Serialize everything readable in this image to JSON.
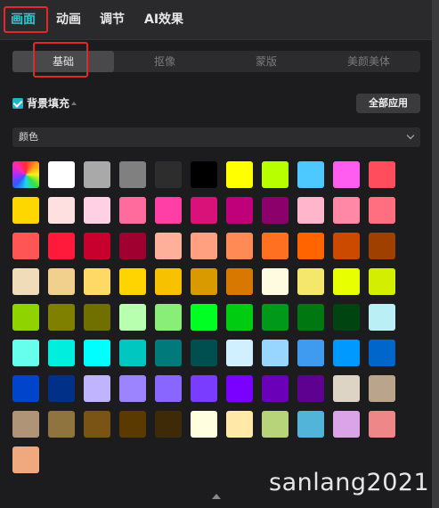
{
  "top_tabs": [
    {
      "label": "画面",
      "active": true
    },
    {
      "label": "动画",
      "active": false
    },
    {
      "label": "调节",
      "active": false
    },
    {
      "label": "AI效果",
      "active": false
    }
  ],
  "sub_tabs": [
    {
      "label": "基础",
      "active": true
    },
    {
      "label": "抠像",
      "active": false
    },
    {
      "label": "蒙版",
      "active": false
    },
    {
      "label": "美颜美体",
      "active": false
    }
  ],
  "fill": {
    "checked": true,
    "label": "背景填充",
    "apply_all_label": "全部应用"
  },
  "dropdown": {
    "value": "颜色"
  },
  "accent_color": "#31c5d2",
  "swatch_rows": [
    [
      "rainbow",
      "#ffffff",
      "#a9a9a9",
      "#808080",
      "#2d2d2d",
      "#000000",
      "#ffff00",
      "#b8ff00",
      "#4dc9ff",
      "#ff5cf0",
      "#ff4d5e"
    ],
    [
      "#ffd700",
      "#ffe0e0",
      "#ffd0e4",
      "#ff6b9c",
      "#ff3fa6",
      "#d9127a",
      "#c0007a",
      "#8b006b",
      "#ffb6cc",
      "#ff88a6",
      "#ff6f7f"
    ],
    [
      "#ff5555",
      "#ff1a3c",
      "#c8002e",
      "#a00030",
      "#ffb09a",
      "#ffa080",
      "#ff8a55",
      "#ff7020",
      "#ff6400",
      "#cc4a00",
      "#a04000"
    ],
    [
      "#f0dcb8",
      "#f0d08c",
      "#ffd966",
      "#ffd400",
      "#f7c100",
      "#d99a00",
      "#d97800",
      "#fffbe0",
      "#f5e66c",
      "#e8ff00",
      "#d4ee00"
    ],
    [
      "#8fd400",
      "#808000",
      "#707000",
      "#b8ffb0",
      "#88ee77",
      "#00ff22",
      "#00cc11",
      "#00991a",
      "#007711",
      "#004411",
      "#baf0f5"
    ],
    [
      "#66ffee",
      "#00eedd",
      "#00ffff",
      "#00c8c0",
      "#007a7a",
      "#004f50",
      "#d0f0ff",
      "#99d6ff",
      "#3f9bf0",
      "#0099ff",
      "#0066cc"
    ],
    [
      "#0044cc",
      "#003088",
      "#c0b4ff",
      "#9c84ff",
      "#8866ff",
      "#7a3dff",
      "#7a00ff",
      "#6a00b8",
      "#5e0090",
      "#ddd4c6",
      "#bba48c"
    ],
    [
      "#b09478",
      "#8f7440",
      "#7a5414",
      "#5a3a00",
      "#3f2a08",
      "#ffffe0",
      "#ffe8a8",
      "#b8d47a",
      "#52b4d8",
      "#dca4e8",
      "#ee8888"
    ],
    [
      "#f0a87e"
    ]
  ],
  "watermark": "sanlang2021"
}
